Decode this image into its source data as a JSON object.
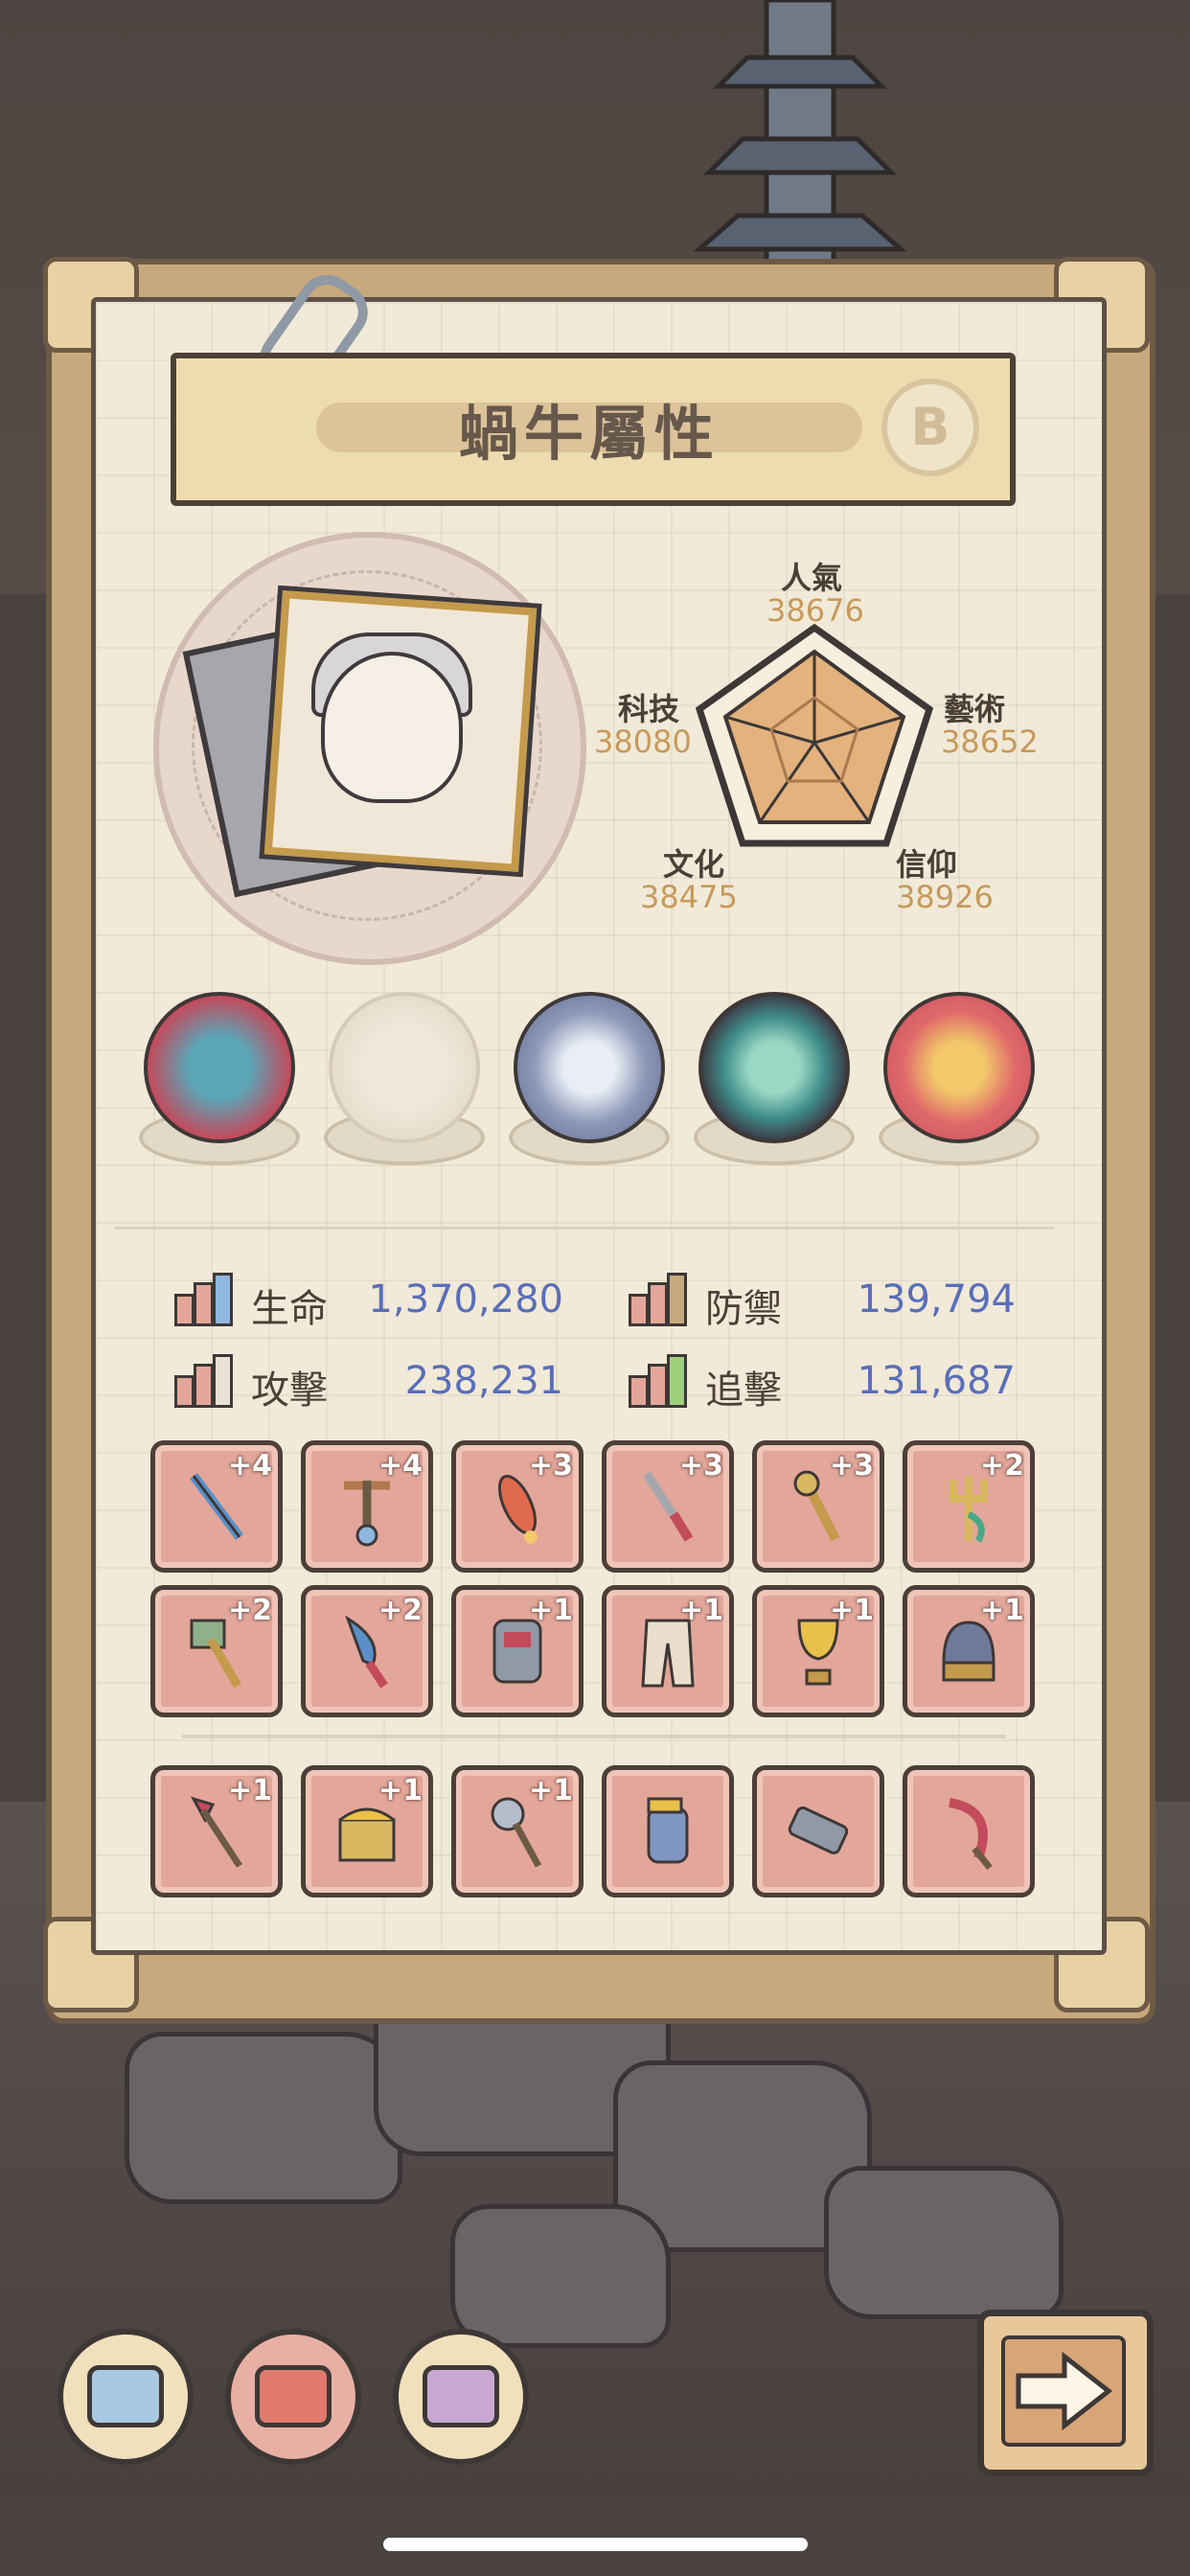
{
  "panel": {
    "title": "蝸牛屬性",
    "badge": "B"
  },
  "radar": {
    "popularity": {
      "label": "人氣",
      "value": "38676"
    },
    "art": {
      "label": "藝術",
      "value": "38652"
    },
    "faith": {
      "label": "信仰",
      "value": "38926"
    },
    "culture": {
      "label": "文化",
      "value": "38475"
    },
    "tech": {
      "label": "科技",
      "value": "38080"
    }
  },
  "orbs": [
    "spiky-creature-orb-icon",
    "snail-shell-orb-icon",
    "compass-orb-icon",
    "swirl-orb-icon",
    "red-swirl-orb-icon"
  ],
  "stats": {
    "hp": {
      "label": "生命",
      "value": "1,370,280"
    },
    "defense": {
      "label": "防禦",
      "value": "139,794"
    },
    "attack": {
      "label": "攻擊",
      "value": "238,231"
    },
    "pursuit": {
      "label": "追擊",
      "value": "131,687"
    }
  },
  "items_row1": [
    "+4",
    "+4",
    "+3",
    "+3",
    "+3",
    "+2"
  ],
  "items_row2": [
    "+2",
    "+2",
    "+1",
    "+1",
    "+1",
    "+1"
  ],
  "items_row3": [
    "+1",
    "+1",
    "+1",
    "",
    "",
    ""
  ],
  "colors": {
    "stat_value": "#5a6eb8",
    "radar_value": "#c69a5c",
    "slot_bg": "#e3a69a",
    "radar_fill": "#e3b27d"
  }
}
